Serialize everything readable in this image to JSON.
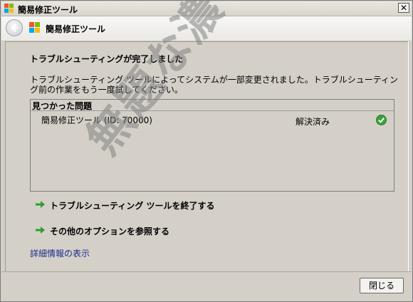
{
  "window": {
    "title": "簡易修正ツール",
    "close_glyph": "✕"
  },
  "header": {
    "title": "簡易修正ツール"
  },
  "content": {
    "heading": "トラブルシューティングが完了しました",
    "message": "トラブルシューティング ツールによってシステムが一部変更されました。トラブルシューティング前の作業をもう一度試してください。",
    "problems": {
      "header": "見つかった問題",
      "items": [
        {
          "name": "簡易修正ツール (ID: 70000)",
          "status": "解決済み"
        }
      ]
    },
    "actions": [
      {
        "label": "トラブルシューティング ツールを終了する"
      },
      {
        "label": "その他のオプションを参照する"
      }
    ],
    "details_link": "詳細情報の表示"
  },
  "footer": {
    "close_label": "閉じる"
  },
  "watermark": "無題な濃いログ",
  "colors": {
    "accent_green": "#2f9e2f",
    "link_blue": "#1b2b8c"
  }
}
